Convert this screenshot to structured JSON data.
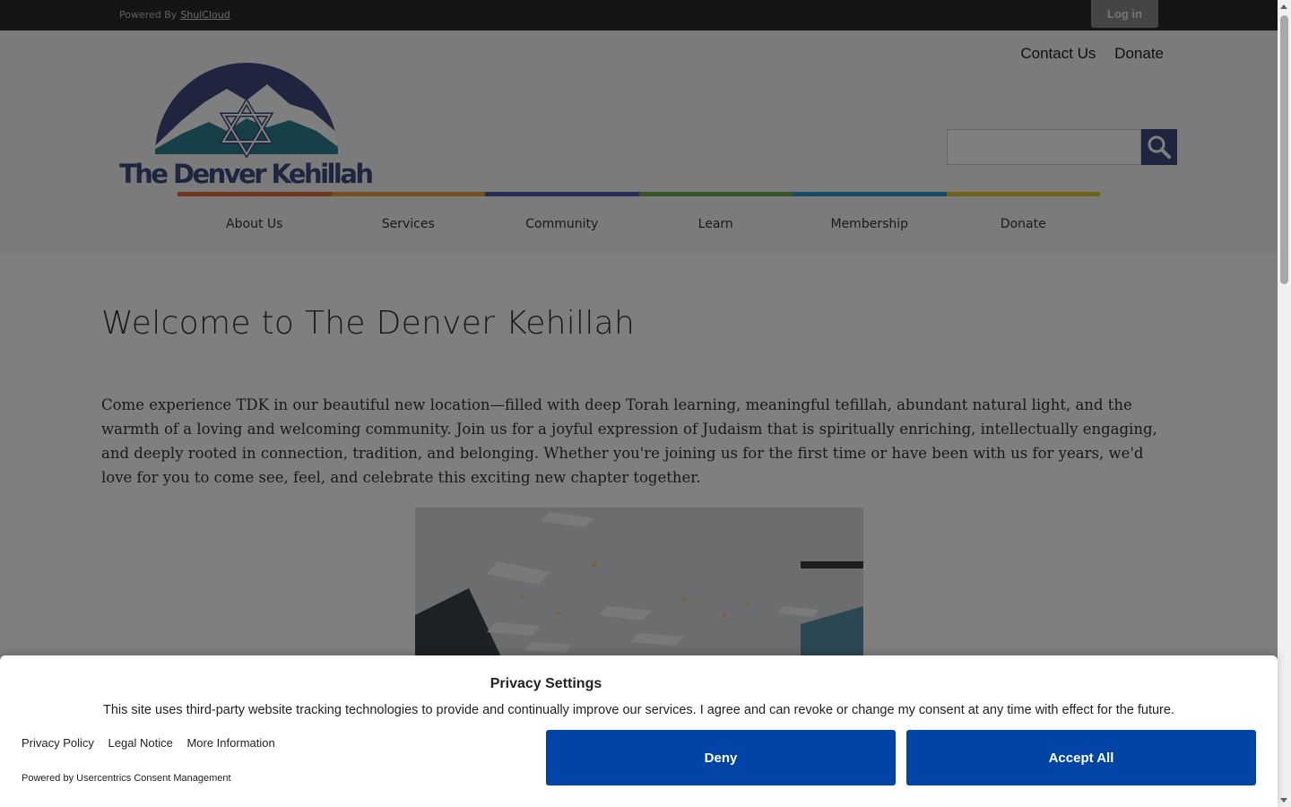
{
  "topbar": {
    "powered_label": "Powered By",
    "powered_link": "ShulCloud",
    "login_label": "Log in"
  },
  "header": {
    "logo_text": "The Denver Kehillah",
    "utility_links": [
      "Contact Us",
      "Donate"
    ],
    "search_placeholder": "",
    "nav": [
      "About Us",
      "Services",
      "Community",
      "Learn",
      "Membership",
      "Donate"
    ],
    "nav_colors": [
      "#e06a3b",
      "#e8a43a",
      "#4a5aa8",
      "#6aa84f",
      "#2b9bd3",
      "#e1c234"
    ]
  },
  "main": {
    "title": "Welcome to The Denver Kehillah",
    "intro": "Come experience TDK in our beautiful new location—filled with deep Torah learning, meaningful tefillah, abundant natural light, and the warmth of a loving and welcoming community. Join us for a joyful expression of Judaism that is spiritually enriching, intellectually engaging, and deeply rooted in connection, tradition, and belonging. Whether you're joining us for the first time or have been with us for years, we'd love for you to come see, feel, and celebrate this exciting new chapter together."
  },
  "consent": {
    "title": "Privacy Settings",
    "text": "This site uses third-party website tracking technologies to provide and continually improve our services. I agree and can revoke or change my consent at any time with effect for the future.",
    "links": [
      "Privacy Policy",
      "Legal Notice",
      "More Information"
    ],
    "powered": "Powered by Usercentrics Consent Management",
    "deny_label": "Deny",
    "accept_label": "Accept All",
    "button_color": "#0045a5"
  },
  "icons": {
    "search": "search-icon",
    "star_of_david": "star-of-david-icon"
  }
}
